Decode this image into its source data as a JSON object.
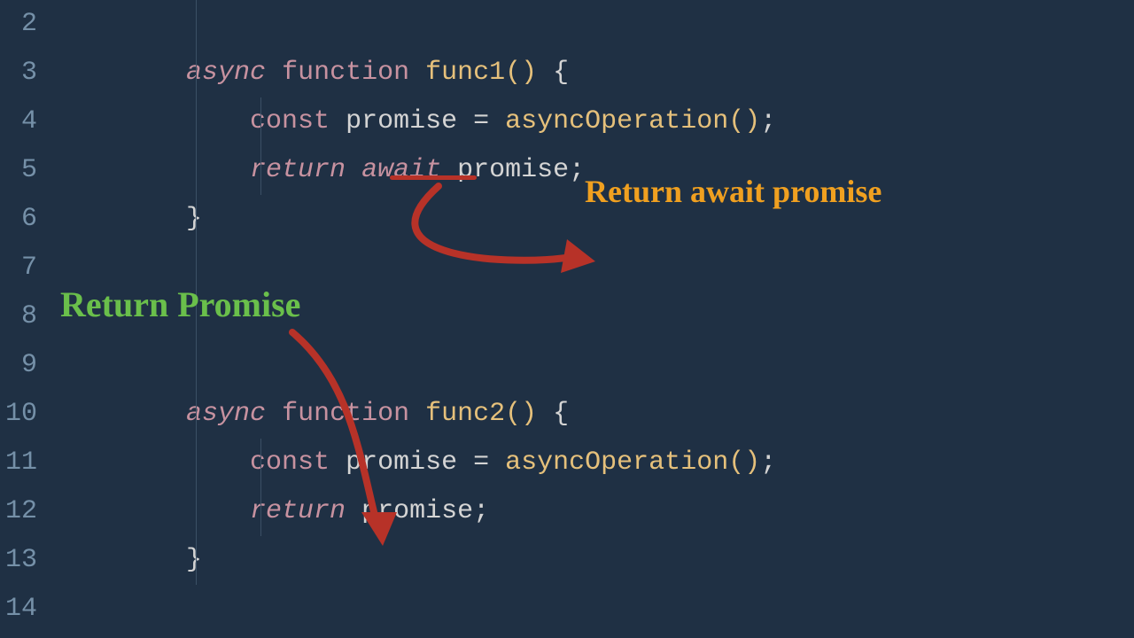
{
  "gutter": {
    "start": 2,
    "end": 14
  },
  "tokens": {
    "async": "async",
    "function": "function",
    "func1": "func1",
    "func2": "func2",
    "const": "const",
    "promise": "promise",
    "eq": "=",
    "asyncOperation": "asyncOperation",
    "return": "return",
    "await": "await",
    "lparen": "(",
    "rparen": ")",
    "lbrace": "{",
    "rbrace": "}",
    "semi": ";",
    "args": "()"
  },
  "annotations": {
    "returnAwait": "Return await promise",
    "returnPromise": "Return Promise"
  },
  "colors": {
    "background": "#1f3044",
    "gutter": "#7590a8",
    "keyword": "#c792a0",
    "function": "#e5c07b",
    "text": "#d4d4d4",
    "annotationOrange": "#f0a020",
    "annotationGreen": "#6abf4b",
    "arrow": "#b73228"
  }
}
